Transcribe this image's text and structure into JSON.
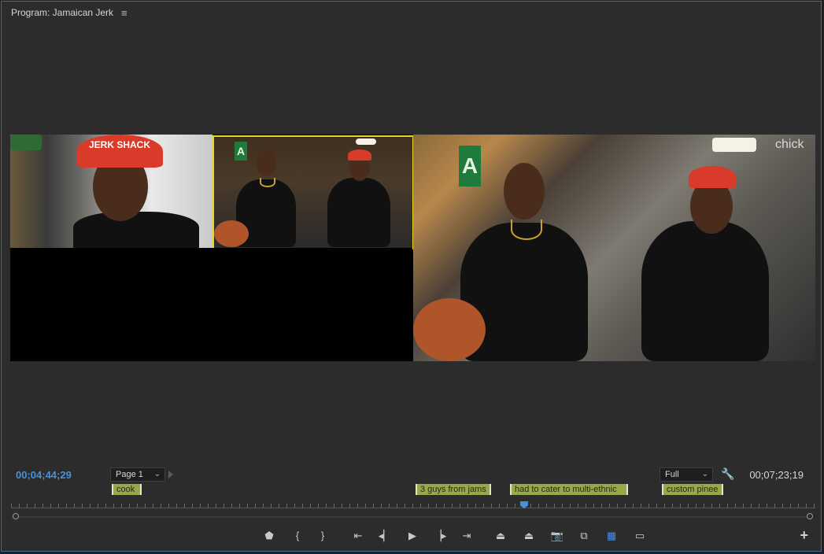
{
  "panel": {
    "title": "Program: Jamaican Jerk"
  },
  "video": {
    "cap_text": "JERK SHACK",
    "sign_letter": "A",
    "shelf_sign": "chick"
  },
  "timecode": {
    "current": "00;04;44;29",
    "duration": "00;07;23;19"
  },
  "controls_bar": {
    "page_select": "Page 1",
    "zoom_select": "Full"
  },
  "markers": [
    {
      "label": "cook"
    },
    {
      "label": "3 guys from jams"
    },
    {
      "label": "had to cater to multi-ethnic"
    },
    {
      "label": "custom pinee"
    }
  ],
  "transport": [
    {
      "icon": "marker-icon",
      "glyph": "⬟"
    },
    {
      "icon": "mark-in-icon",
      "glyph": "{"
    },
    {
      "icon": "mark-out-icon",
      "glyph": "}"
    },
    {
      "icon": "go-to-in-icon",
      "glyph": "⇤"
    },
    {
      "icon": "step-back-icon",
      "glyph": "◂▏"
    },
    {
      "icon": "play-icon",
      "glyph": "▶"
    },
    {
      "icon": "step-forward-icon",
      "glyph": "▕▸"
    },
    {
      "icon": "go-to-out-icon",
      "glyph": "⇥"
    },
    {
      "icon": "lift-icon",
      "glyph": "⏏"
    },
    {
      "icon": "extract-icon",
      "glyph": "⏏"
    },
    {
      "icon": "export-frame-icon",
      "glyph": "📷"
    },
    {
      "icon": "compare-view-icon",
      "glyph": "⧉"
    },
    {
      "icon": "multicam-view-icon",
      "glyph": "▦"
    },
    {
      "icon": "safe-margins-icon",
      "glyph": "▭"
    }
  ],
  "colors": {
    "accent": "#4a90d9",
    "marker": "#96a84a",
    "highlight": "#e6d82a"
  }
}
